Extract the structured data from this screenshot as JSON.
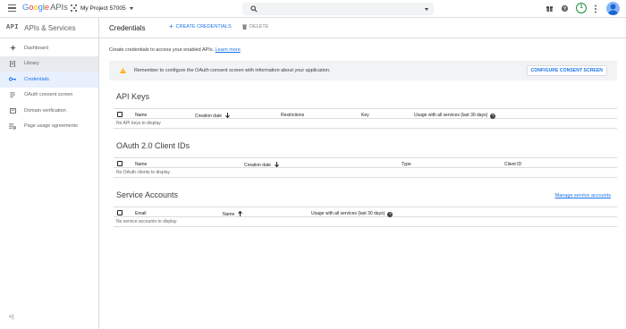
{
  "topbar": {
    "logo_letters": [
      "G",
      "o",
      "o",
      "g",
      "l",
      "e"
    ],
    "logo_suffix": "APIs",
    "project": "My Project 57005",
    "notification_count": "1"
  },
  "sidebar": {
    "badge": "API",
    "title": "APIs & Services",
    "items": [
      {
        "label": "Dashboard",
        "icon": "dashboard-icon"
      },
      {
        "label": "Library",
        "icon": "library-icon"
      },
      {
        "label": "Credentials",
        "icon": "key-icon"
      },
      {
        "label": "OAuth consent screen",
        "icon": "consent-icon"
      },
      {
        "label": "Domain verification",
        "icon": "domain-icon"
      },
      {
        "label": "Page usage agreements",
        "icon": "settings-list-icon"
      }
    ],
    "collapse_label": "<|"
  },
  "main": {
    "title": "Credentials",
    "create_label": "CREATE CREDENTIALS",
    "delete_label": "DELETE",
    "intro_text": "Create credentials to access your enabled APIs.",
    "intro_link": "Learn more",
    "banner_text": "Remember to configure the OAuth consent screen with information about your application.",
    "banner_button": "CONFIGURE CONSENT SCREEN",
    "api_keys": {
      "title": "API Keys",
      "columns": [
        "Name",
        "Creation date",
        "Restrictions",
        "Key",
        "Usage with all services (last 30 days)"
      ],
      "empty": "No API keys to display"
    },
    "oauth": {
      "title": "OAuth 2.0 Client IDs",
      "columns": [
        "Name",
        "Creation date",
        "Type",
        "Client ID"
      ],
      "empty": "No OAuth clients to display"
    },
    "service_accounts": {
      "title": "Service Accounts",
      "manage_link": "Manage service accounts",
      "columns": [
        "Email",
        "Name",
        "Usage with all services (last 30 days)"
      ],
      "empty": "No service accounts to display"
    }
  },
  "colors": {
    "accent": "#1a73e8",
    "warning": "#f9ab00",
    "badge_green": "#1e8e3e"
  }
}
